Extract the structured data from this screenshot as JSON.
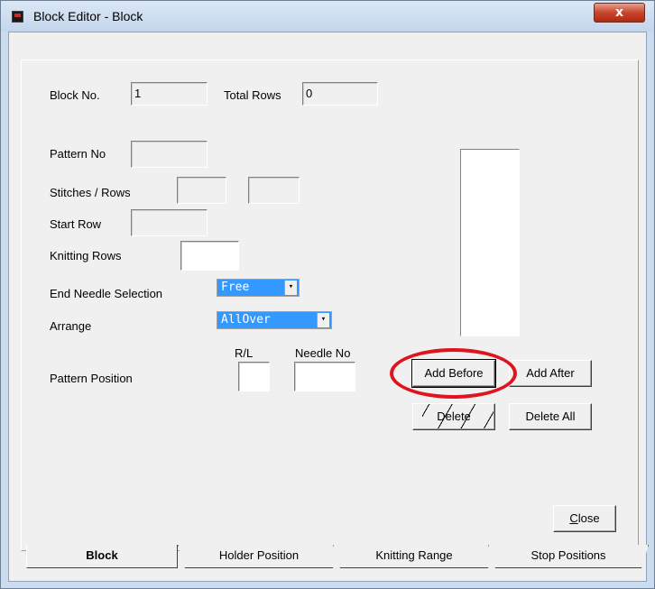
{
  "window": {
    "title": "Block Editor - Block",
    "close_glyph": "x"
  },
  "fields": {
    "block_no_label": "Block No.",
    "block_no_value": "1",
    "total_rows_label": "Total Rows",
    "total_rows_value": "0",
    "pattern_no_label": "Pattern No",
    "pattern_no_value": "",
    "stitches_rows_label": "Stitches / Rows",
    "stitches_value": "",
    "rows_value": "",
    "start_row_label": "Start Row",
    "start_row_value": "",
    "knitting_rows_label": "Knitting Rows",
    "knitting_rows_value": "",
    "end_needle_label": "End Needle Selection",
    "end_needle_value": "Free",
    "arrange_label": "Arrange",
    "arrange_value": "AllOver",
    "pattern_position_label": "Pattern Position",
    "rl_label": "R/L",
    "rl_value": "",
    "needle_no_label": "Needle No",
    "needle_no_value": ""
  },
  "buttons": {
    "add_before": "Add Before",
    "add_after": "Add After",
    "delete": "Delete",
    "delete_all": "Delete All",
    "close_prefix": "C",
    "close_rest": "lose"
  },
  "tabs": [
    {
      "label": "Block",
      "active": true
    },
    {
      "label": "Holder Position",
      "active": false
    },
    {
      "label": "Knitting Range",
      "active": false
    },
    {
      "label": "Stop Positions",
      "active": false
    }
  ],
  "colors": {
    "selection": "#3399ff",
    "annotation": "#e0141e"
  }
}
